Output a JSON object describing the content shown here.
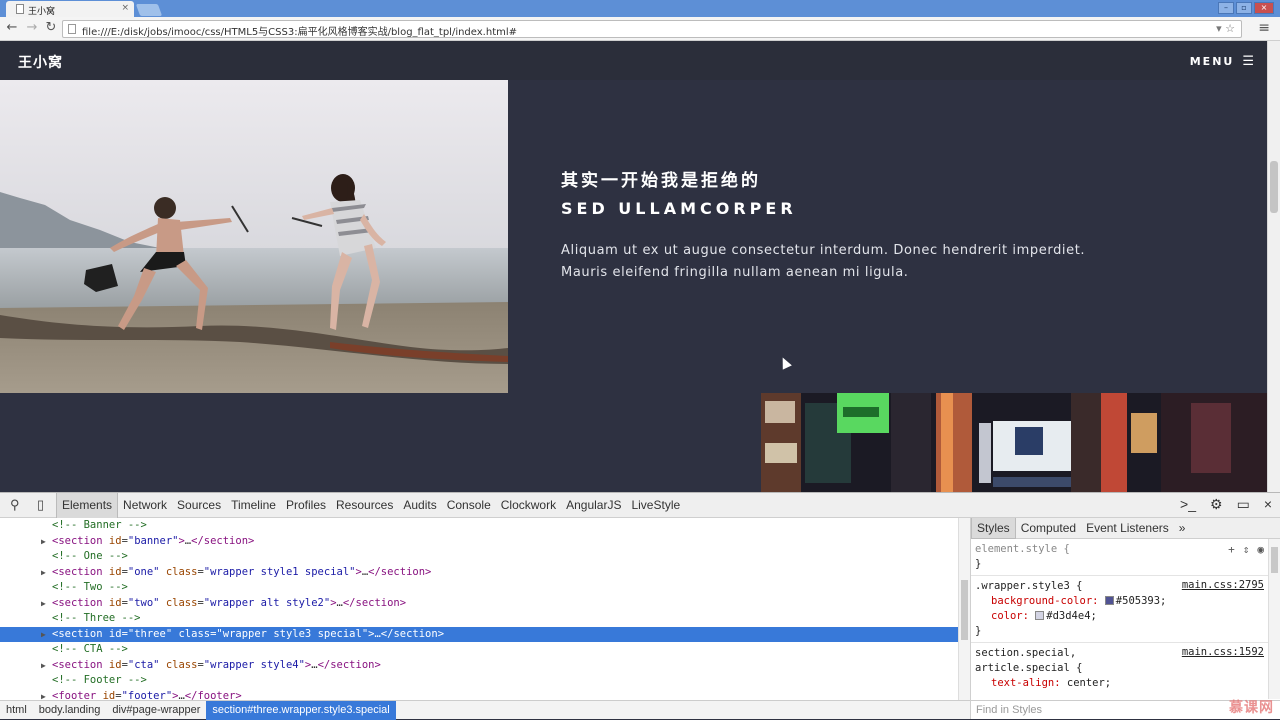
{
  "browser": {
    "tab_title": "王小窝",
    "tab_close": "×",
    "url": "file:///E:/disk/jobs/imooc/css/HTML5与CSS3:扁平化风格博客实战/blog_flat_tpl/index.html#",
    "window_buttons": [
      "–",
      "▫",
      "×"
    ]
  },
  "site": {
    "logo": "王小窝",
    "menu_label": "MENU",
    "heading_cn": "其实一开始我是拒绝的",
    "heading_en": "SED ULLAMCORPER",
    "paragraph_line1": "Aliquam ut ex ut augue consectetur interdum. Donec hendrerit imperdiet.",
    "paragraph_line2": "Mauris eleifend fringilla nullam aenean mi ligula."
  },
  "devtools": {
    "tabs": [
      "Elements",
      "Network",
      "Sources",
      "Timeline",
      "Profiles",
      "Resources",
      "Audits",
      "Console",
      "Clockwork",
      "AngularJS",
      "LiveStyle"
    ],
    "dom": [
      {
        "kind": "comment",
        "text": "<!-- Banner -->"
      },
      {
        "kind": "tag",
        "id": "banner",
        "cls": "",
        "selected": false
      },
      {
        "kind": "comment",
        "text": "<!-- One -->"
      },
      {
        "kind": "tag",
        "id": "one",
        "cls": "wrapper style1 special",
        "selected": false
      },
      {
        "kind": "comment",
        "text": "<!-- Two -->"
      },
      {
        "kind": "tag",
        "id": "two",
        "cls": "wrapper alt style2",
        "selected": false
      },
      {
        "kind": "comment",
        "text": "<!-- Three -->"
      },
      {
        "kind": "tag",
        "id": "three",
        "cls": "wrapper style3 special",
        "selected": true
      },
      {
        "kind": "comment",
        "text": "<!-- CTA -->"
      },
      {
        "kind": "tag",
        "id": "cta",
        "cls": "wrapper style4",
        "selected": false
      },
      {
        "kind": "comment",
        "text": "<!-- Footer -->"
      },
      {
        "kind": "footer",
        "id": "footer",
        "cls": "",
        "selected": false
      }
    ],
    "breadcrumbs": [
      "html",
      "body.landing",
      "div#page-wrapper",
      "section#three.wrapper.style3.special"
    ],
    "styles_tabs": [
      "Styles",
      "Computed",
      "Event Listeners",
      "»"
    ],
    "element_style": "element.style {",
    "rule1_selector": ".wrapper.style3 {",
    "rule1_source": "main.css:2795",
    "rule1_prop1_name": "background-color:",
    "rule1_prop1_value": "#505393;",
    "rule1_prop1_swatch": "#505393",
    "rule1_prop2_name": "color:",
    "rule1_prop2_value": "#d3d4e4;",
    "rule1_prop2_swatch": "#d3d4e4",
    "rule2_selector1": "section.special,",
    "rule2_selector2": "article.special {",
    "rule2_source": "main.css:1592",
    "rule2_prop1_name": "text-align:",
    "rule2_prop1_value": "center;",
    "close_brace": "}",
    "find_placeholder": "Find in Styles",
    "watermark": "慕课网"
  }
}
